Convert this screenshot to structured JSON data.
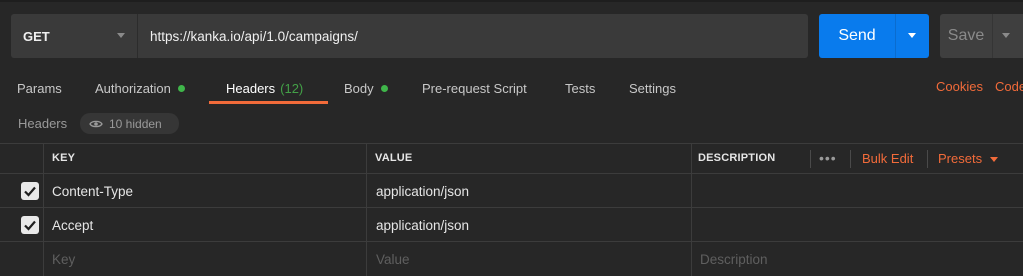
{
  "request": {
    "method": "GET",
    "url": "https://kanka.io/api/1.0/campaigns/",
    "send_label": "Send",
    "save_label": "Save"
  },
  "tabs": [
    {
      "label": "Params"
    },
    {
      "label": "Authorization",
      "has_dot": true
    },
    {
      "label": "Headers",
      "count": "(12)",
      "active": true
    },
    {
      "label": "Body",
      "has_dot": true
    },
    {
      "label": "Pre-request Script"
    },
    {
      "label": "Tests"
    },
    {
      "label": "Settings"
    }
  ],
  "right_links": {
    "cookies": "Cookies",
    "code": "Code"
  },
  "section": {
    "title": "Headers",
    "hidden_label": "10 hidden",
    "hidden_icon": "eye-icon"
  },
  "table": {
    "columns": {
      "key": "KEY",
      "value": "VALUE",
      "description": "DESCRIPTION"
    },
    "actions": {
      "more": "•••",
      "bulk_edit": "Bulk Edit",
      "presets": "Presets"
    },
    "rows": [
      {
        "checked": true,
        "key": "Content-Type",
        "value": "application/json",
        "description": ""
      },
      {
        "checked": true,
        "key": "Accept",
        "value": "application/json",
        "description": ""
      }
    ],
    "placeholders": {
      "key": "Key",
      "value": "Value",
      "description": "Description"
    }
  },
  "colors": {
    "accent": "#f26b3a",
    "primary": "#097bed",
    "status_dot": "#3fb64a",
    "background": "#272727"
  }
}
